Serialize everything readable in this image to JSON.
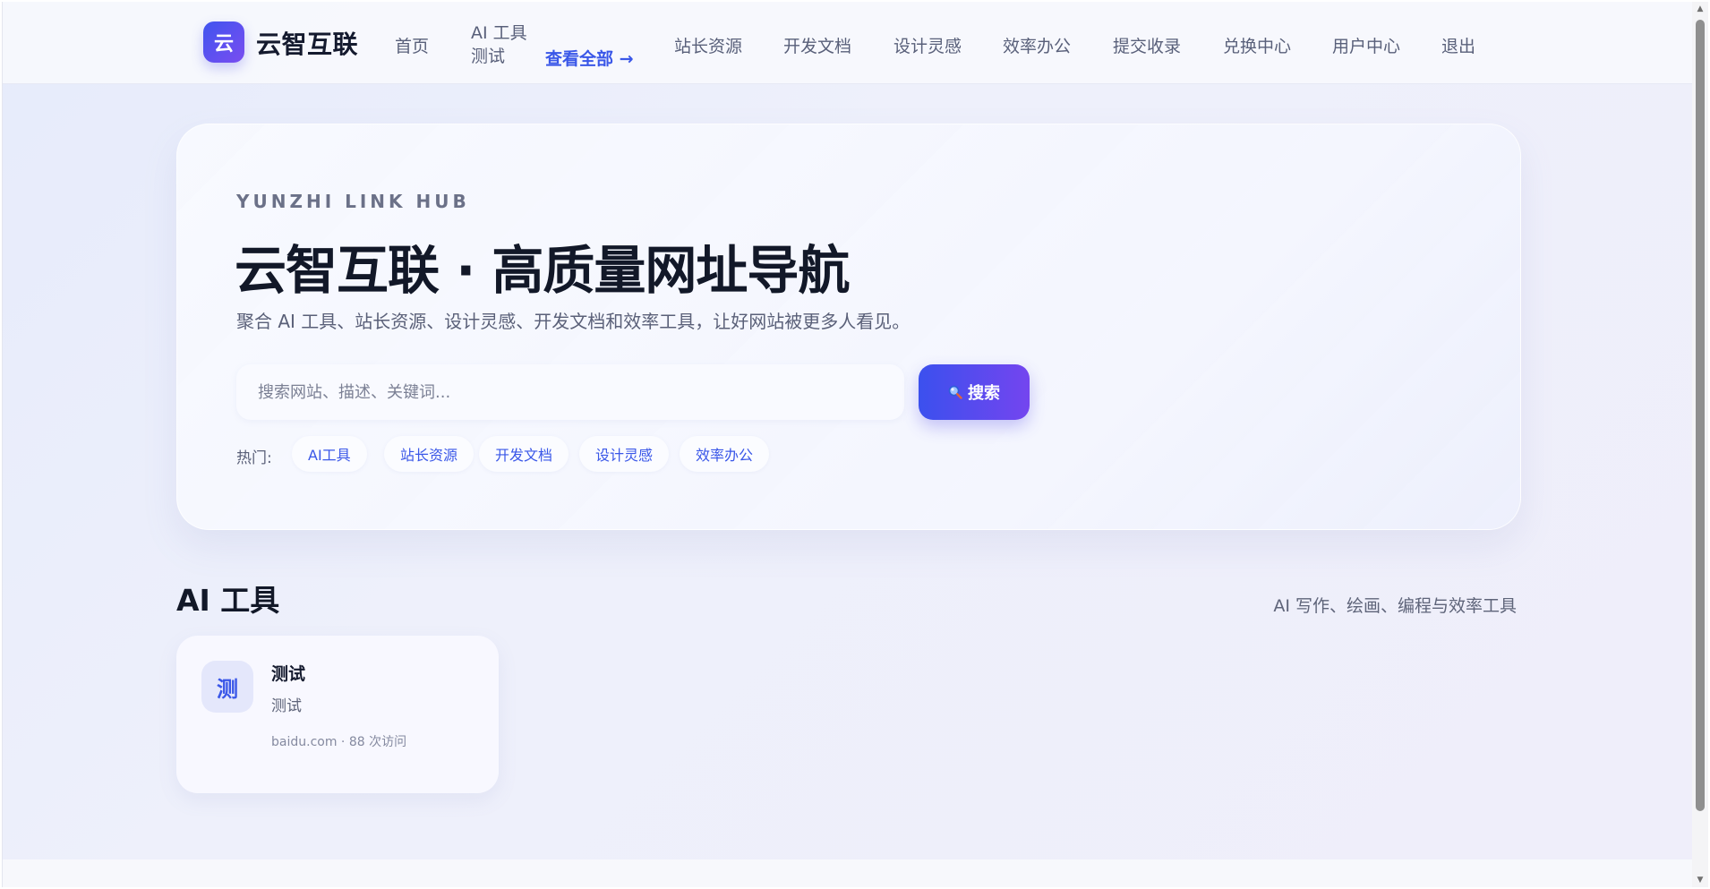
{
  "header": {
    "logo_glyph": "云",
    "brand": "云智互联",
    "nav": {
      "home": "首页",
      "ai_tools_line1": "AI 工具",
      "ai_tools_line2": "测试",
      "view_all": "查看全部 →",
      "webmaster": "站长资源",
      "dev_docs": "开发文档",
      "design": "设计灵感",
      "office": "效率办公",
      "submit": "提交收录",
      "exchange": "兑换中心",
      "user_center": "用户中心",
      "logout": "退出"
    }
  },
  "hero": {
    "eyebrow": "YUNZHI LINK HUB",
    "title": "云智互联 · 高质量网址导航",
    "subtitle": "聚合 AI 工具、站长资源、设计灵感、开发文档和效率工具，让好网站被更多人看见。",
    "search": {
      "placeholder": "搜索网站、描述、关键词...",
      "button_label": "搜索",
      "icon": "search-icon"
    },
    "hot_label": "热门:",
    "hot_tags": [
      "AI工具",
      "站长资源",
      "开发文档",
      "设计灵感",
      "效率办公"
    ]
  },
  "section": {
    "title": "AI 工具",
    "description": "AI 写作、绘画、编程与效率工具",
    "cards": [
      {
        "avatar_glyph": "测",
        "title": "测试",
        "description": "测试",
        "meta": "baidu.com · 88 次访问"
      }
    ]
  },
  "colors": {
    "accent": "#3a57e8",
    "brand_gradient_start": "#3f54ef",
    "brand_gradient_end": "#7a4df0",
    "text_dark": "#121828"
  }
}
